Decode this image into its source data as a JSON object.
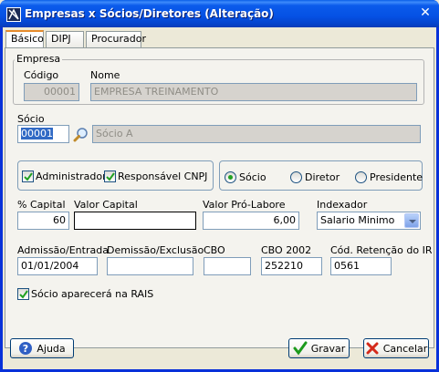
{
  "window": {
    "title": "Empresas x Sócios/Diretores (Alteração)"
  },
  "tabs": [
    {
      "label": "Básico"
    },
    {
      "label": "DIPJ"
    },
    {
      "label": "Procurador"
    }
  ],
  "empresa": {
    "legend": "Empresa",
    "codigo_label": "Código",
    "codigo_value": "00001",
    "nome_label": "Nome",
    "nome_value": "EMPRESA TREINAMENTO"
  },
  "socio": {
    "label": "Sócio",
    "code_value": "00001",
    "name_value": "Sócio A"
  },
  "flags": {
    "administrador": {
      "label": "Administrador",
      "checked": true
    },
    "responsavel_cnpj": {
      "label": "Responsável CNPJ",
      "checked": true
    }
  },
  "tipo": {
    "options": [
      {
        "label": "Sócio",
        "selected": true
      },
      {
        "label": "Diretor",
        "selected": false
      },
      {
        "label": "Presidente",
        "selected": false
      }
    ]
  },
  "fields": {
    "capital_label": "% Capital",
    "capital_value": "60",
    "valor_capital_label": "Valor Capital",
    "valor_capital_value": "",
    "pro_labore_label": "Valor Pró-Labore",
    "pro_labore_value": "6,00",
    "indexador_label": "Indexador",
    "indexador_value": "Salario Minimo",
    "admissao_label": "Admissão/Entrada",
    "admissao_value": "01/01/2004",
    "demissao_label": "Demissão/Exclusão",
    "demissao_value": "",
    "cbo_label": "CBO",
    "cbo_value": "",
    "cbo2002_label": "CBO 2002",
    "cbo2002_value": "252210",
    "retencao_label": "Cód. Retenção do IR",
    "retencao_value": "0561"
  },
  "rais": {
    "label": "Sócio aparecerá na RAIS",
    "checked": true
  },
  "buttons": {
    "help": "Ajuda",
    "save": "Gravar",
    "cancel": "Cancelar"
  },
  "colors": {
    "titlebar": "#0551E4",
    "selection": "#316AC5",
    "check": "#21A121"
  }
}
